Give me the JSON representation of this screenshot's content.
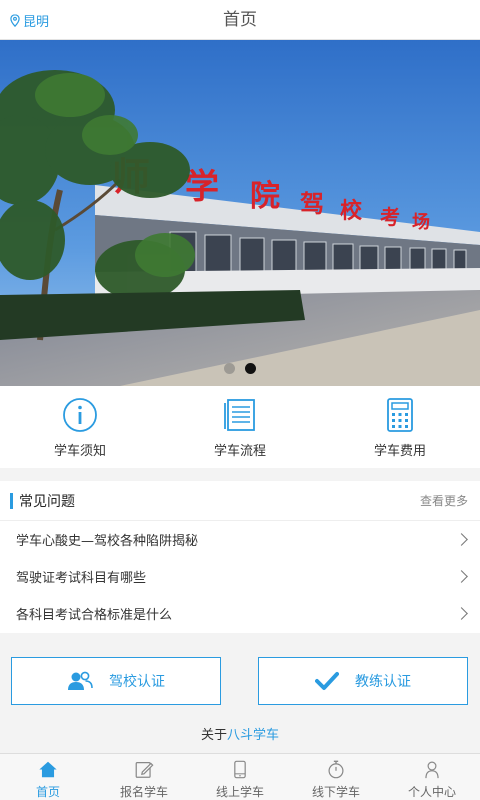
{
  "header": {
    "location": "昆明",
    "title": "首页"
  },
  "banner": {
    "slide_count": 2,
    "active_slide": 2,
    "sign_text": "师学院驾校"
  },
  "quick_menu": [
    {
      "label": "学车须知",
      "icon": "info-icon"
    },
    {
      "label": "学车流程",
      "icon": "document-icon"
    },
    {
      "label": "学车费用",
      "icon": "calculator-icon"
    }
  ],
  "faq": {
    "title": "常见问题",
    "more": "查看更多",
    "items": [
      "学车心酸史—驾校各种陷阱揭秘",
      "驾驶证考试科目有哪些",
      "各科目考试合格标准是什么"
    ]
  },
  "certs": {
    "school": {
      "label": "驾校认证",
      "icon": "users-icon"
    },
    "coach": {
      "label": "教练认证",
      "icon": "check-icon"
    }
  },
  "about": {
    "prefix": "关于",
    "link": "八斗学车"
  },
  "tabs": [
    {
      "label": "首页",
      "icon": "home-icon",
      "active": true
    },
    {
      "label": "报名学车",
      "icon": "edit-icon",
      "active": false
    },
    {
      "label": "线上学车",
      "icon": "phone-icon",
      "active": false
    },
    {
      "label": "线下学车",
      "icon": "stopwatch-icon",
      "active": false
    },
    {
      "label": "个人中心",
      "icon": "person-icon",
      "active": false
    }
  ],
  "colors": {
    "accent": "#2a9be0",
    "sky": "#3f7fd0",
    "sign_red": "#d8232a"
  }
}
